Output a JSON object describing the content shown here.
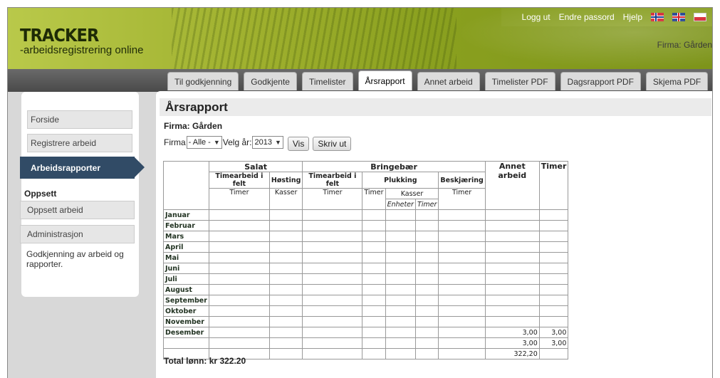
{
  "header": {
    "logo_title": "TRACKER",
    "logo_subtitle": "-arbeidsregistrering online",
    "nav": [
      "Logg ut",
      "Endre passord",
      "Hjelp"
    ],
    "firma": "Firma: Gården"
  },
  "tabs": [
    "Til godkjenning",
    "Godkjente",
    "Timelister",
    "Årsrapport",
    "Annet arbeid",
    "Timelister PDF",
    "Dagsrapport PDF",
    "Skjema PDF"
  ],
  "active_tab": "Årsrapport",
  "sidebar": {
    "items": [
      "Forside",
      "Registrere arbeid",
      "Arbeidsrapporter"
    ],
    "heading": "Oppsett",
    "setup_items": [
      "Oppsett arbeid",
      "Administrasjon"
    ],
    "extra_text": "Godkjenning av arbeid og rapporter."
  },
  "main": {
    "title": "Årsrapport",
    "firma_label": "Firma: Gården",
    "filter": {
      "firma_label": "Firma",
      "firma_value": "- Alle -",
      "year_label": "Velg år:",
      "year_value": "2013",
      "vis_button": "Vis",
      "print_button": "Skriv ut"
    },
    "table": {
      "groups": [
        "Salat",
        "Bringebær",
        "Annet arbeid",
        "Timer"
      ],
      "subgroups": [
        "Timearbeid i felt",
        "Høsting",
        "Timearbeid i felt",
        "Plukking",
        "Beskjæring"
      ],
      "units": [
        "Timer",
        "Kasser",
        "Timer",
        "Timer",
        "Kasser",
        "Timer"
      ],
      "subunits": [
        "Enheter",
        "Timer"
      ],
      "months": [
        "Januar",
        "Februar",
        "Mars",
        "April",
        "Mai",
        "Juni",
        "Juli",
        "August",
        "September",
        "Oktober",
        "November",
        "Desember"
      ],
      "desember_annet": "3,00",
      "desember_timer": "3,00",
      "sum_annet": "3,00",
      "sum_timer": "3,00",
      "lonn_annet": "322,20"
    },
    "total": "Total lønn: kr 322.20"
  }
}
